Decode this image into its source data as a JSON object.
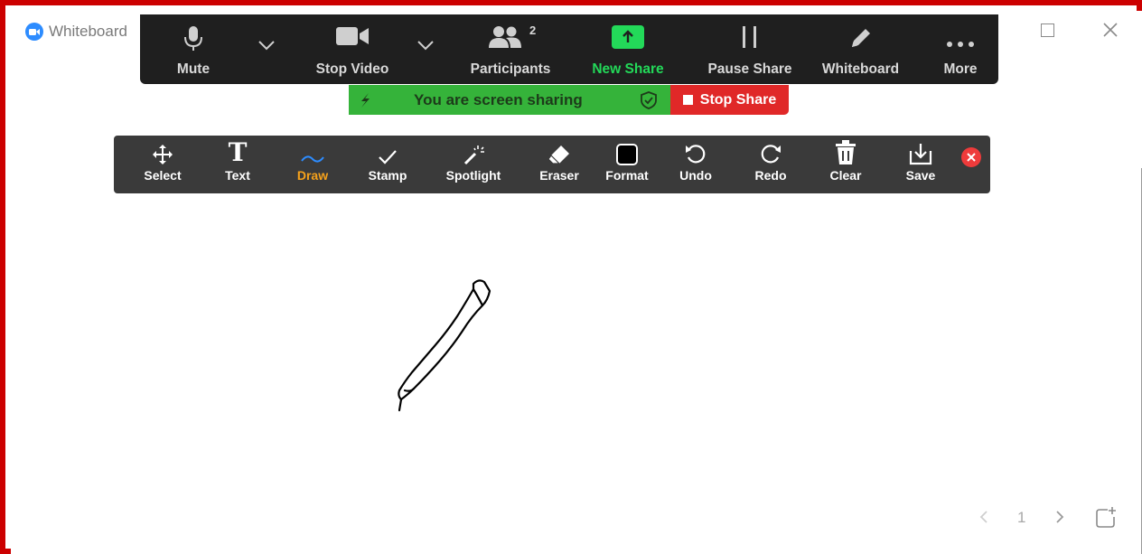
{
  "window": {
    "title": "Whiteboard",
    "icons": {
      "logo": "zoom-camera-logo",
      "maximize": "maximize-icon",
      "close": "close-icon"
    }
  },
  "meeting_controls": {
    "mute": {
      "label": "Mute",
      "icon": "microphone-icon"
    },
    "video": {
      "label": "Stop Video",
      "icon": "video-camera-icon"
    },
    "participants": {
      "label": "Participants",
      "count": "2",
      "icon": "participants-icon"
    },
    "new_share": {
      "label": "New Share",
      "icon": "share-arrow-icon"
    },
    "pause_share": {
      "label": "Pause Share",
      "icon": "pause-icon"
    },
    "whiteboard": {
      "label": "Whiteboard",
      "icon": "pencil-icon"
    },
    "more": {
      "label": "More",
      "icon": "ellipsis-icon"
    }
  },
  "share_banner": {
    "text": "You are screen sharing",
    "stop_label": "Stop Share"
  },
  "annotation_toolbar": {
    "active_tool": "Draw",
    "tools": {
      "select": "Select",
      "text": "Text",
      "draw": "Draw",
      "stamp": "Stamp",
      "spotlight": "Spotlight",
      "eraser": "Eraser",
      "format": "Format",
      "undo": "Undo",
      "redo": "Redo",
      "clear": "Clear",
      "save": "Save"
    }
  },
  "pager": {
    "page": "1"
  },
  "colors": {
    "frame_border": "#cc0000",
    "meeting_bar": "#1f1f1f",
    "share_banner": "#35b33a",
    "stop_share": "#e02828",
    "toolbar": "#3a3a3a",
    "active_tool": "#f7a21b",
    "new_share": "#23d959"
  }
}
